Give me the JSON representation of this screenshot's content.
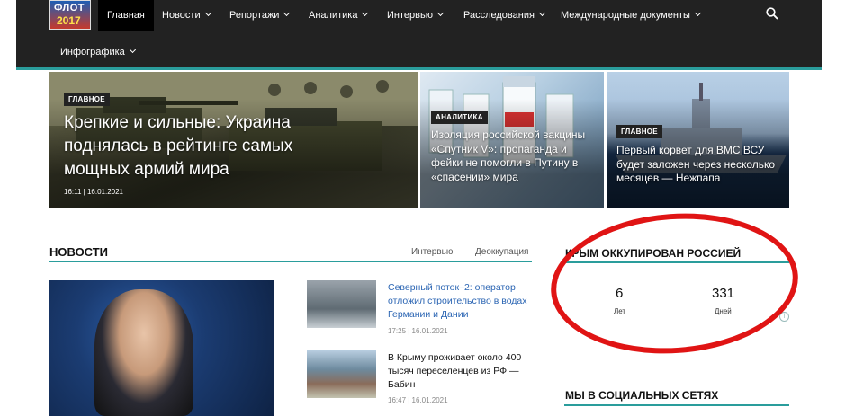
{
  "header": {
    "logo_line1": "ФЛОТ",
    "logo_line2": "2017",
    "nav": [
      {
        "label": "Главная",
        "active": true
      },
      {
        "label": "Новости"
      },
      {
        "label": "Репортажи"
      },
      {
        "label": "Аналитика"
      },
      {
        "label": "Интервью"
      },
      {
        "label": "Расследования"
      },
      {
        "label": "Международные документы"
      },
      {
        "label": "Инфографика"
      }
    ]
  },
  "hero": [
    {
      "tag": "ГЛАВНОЕ",
      "title": "Крепкие и сильные: Украина поднялась в рейтинге самых мощных армий мира",
      "meta": "16:11 | 16.01.2021"
    },
    {
      "tag": "АНАЛИТИКА",
      "title": "Изоляция российской вакцины «Спутник V»: пропаганда и фейки не помогли в Путину в «спасении» мира"
    },
    {
      "tag": "ГЛАВНОЕ",
      "title": "Первый корвет для ВМС ВСУ будет заложен через несколько месяцев — Нежпапа"
    }
  ],
  "news": {
    "heading": "НОВОСТИ",
    "tabs": [
      "Интервью",
      "Деоккупация"
    ],
    "items": [
      {
        "title": "Северный поток–2: оператор отложил строительство в водах Германии и Дании",
        "meta": "17:25 | 16.01.2021"
      },
      {
        "title": "В Крыму проживает около 400 тысяч переселенцев из РФ — Бабин",
        "meta": "16:47 | 16.01.2021"
      }
    ]
  },
  "sidebar": {
    "crimea_title": "КРЫМ ОККУПИРОВАН РОССИЕЙ",
    "years_value": "6",
    "years_label": "Лет",
    "days_value": "331",
    "days_label": "Дней",
    "info": "i",
    "social_title": "МЫ В СОЦИАЛЬНЫХ СЕТЯХ"
  },
  "colors": {
    "accent": "#2a9d9c",
    "nav_bg": "#222222",
    "annotation_ring": "#e01414",
    "link": "#2b65b3"
  }
}
